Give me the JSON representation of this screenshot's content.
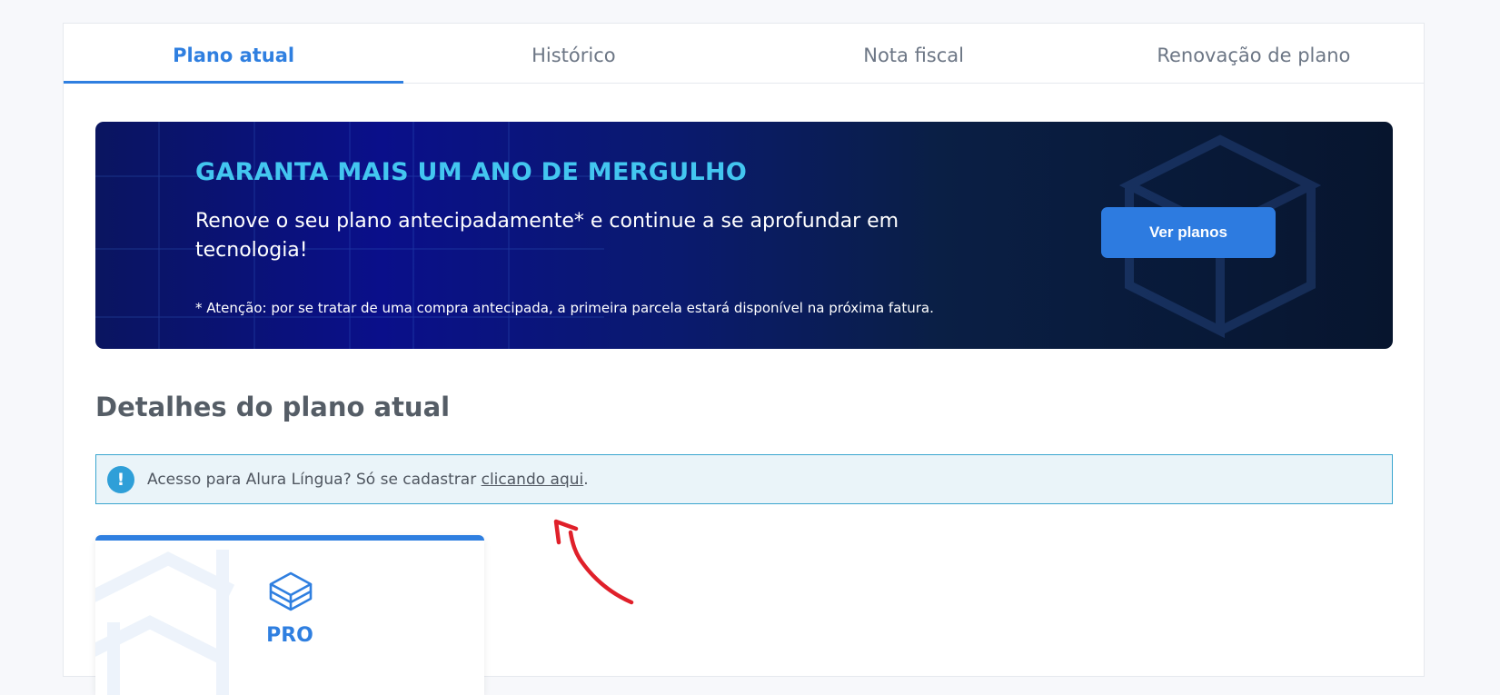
{
  "tabs": [
    {
      "label": "Plano atual",
      "active": true
    },
    {
      "label": "Histórico",
      "active": false
    },
    {
      "label": "Nota fiscal",
      "active": false
    },
    {
      "label": "Renovação de plano",
      "active": false
    }
  ],
  "banner": {
    "title": "GARANTA MAIS UM ANO DE MERGULHO",
    "text": "Renove o seu plano antecipadamente* e continue a se aprofundar em tecnologia!",
    "note": "* Atenção: por se tratar de uma compra antecipada, a primeira parcela estará disponível na próxima fatura.",
    "button_label": "Ver planos"
  },
  "section": {
    "title": "Detalhes do plano atual"
  },
  "alert": {
    "icon": "exclamation-icon",
    "text_before": "Acesso para Alura Língua? Só se cadastrar ",
    "link_text": "clicando aqui",
    "text_after": "."
  },
  "plan": {
    "icon": "cube-icon",
    "label": "PRO"
  },
  "colors": {
    "accent": "#2f7fe0",
    "banner_title": "#43c6f0",
    "alert_border": "#3aa6cf",
    "annotation": "#e0202a"
  }
}
